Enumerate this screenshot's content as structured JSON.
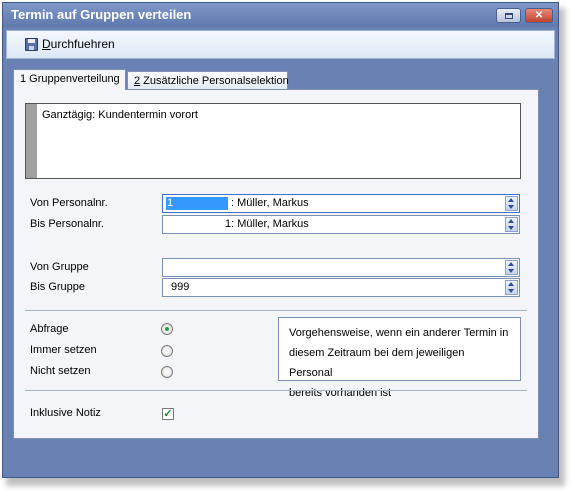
{
  "window": {
    "title": "Termin auf Gruppen verteilen",
    "restore_icon": "restore-icon",
    "close_glyph": "✕",
    "close_icon": "close-icon"
  },
  "toolbar": {
    "execute_icon": "save-disk-icon",
    "execute_hotkey": "D",
    "execute_rest": "urchfuehren"
  },
  "tabs": [
    {
      "label": "1 Gruppenverteilung",
      "active": true
    },
    {
      "hotkey": "2",
      "rest": " Zusätzliche Personalselektion",
      "active": false
    }
  ],
  "memo": {
    "text": "Ganztägig: Kundentermin vorort"
  },
  "fields": {
    "von_personal": {
      "label": "Von Personalnr.",
      "number": "1",
      "name": ": Müller, Markus"
    },
    "bis_personal": {
      "label": "Bis Personalnr.",
      "value": "1: Müller, Markus"
    },
    "von_gruppe": {
      "label": "Von Gruppe",
      "value": ""
    },
    "bis_gruppe": {
      "label": "Bis Gruppe",
      "value": "999"
    }
  },
  "options": {
    "abfrage": {
      "label": "Abfrage",
      "selected": true
    },
    "immer": {
      "label": "Immer setzen",
      "selected": false
    },
    "nicht": {
      "label": "Nicht setzen",
      "selected": false
    },
    "info": {
      "line1": "Vorgehensweise, wenn ein anderer Termin in",
      "line2": "diesem Zeitraum bei dem jeweiligen Personal",
      "line3": "bereits vorhanden ist"
    }
  },
  "notiz": {
    "label": "Inklusive Notiz",
    "checked": true,
    "glyph": "✓"
  },
  "colors": {
    "title_bar": "#6a82b3",
    "accent_selection": "#3399ff",
    "radio_on": "#22a633"
  }
}
